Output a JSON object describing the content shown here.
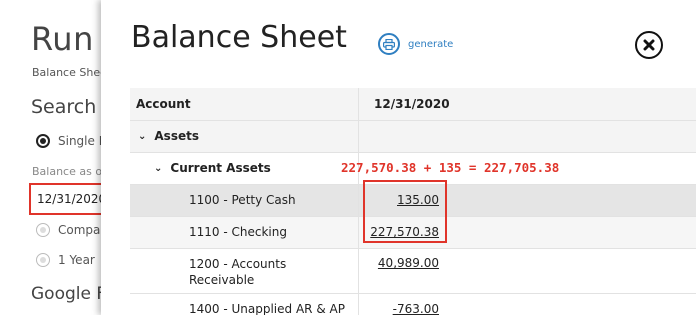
{
  "background": {
    "title": "Run",
    "subtitle": "Balance Shee",
    "search_heading": "Search C",
    "radio_options": [
      "Single F",
      "Compa",
      "1 Year"
    ],
    "balance_label": "Balance as o",
    "date_value": "12/31/2020",
    "google_heading": "Google F"
  },
  "modal": {
    "title": "Balance Sheet",
    "generate_label": "generate",
    "table": {
      "headers": {
        "account": "Account",
        "date": "12/31/2020"
      },
      "groups": {
        "assets": "Assets",
        "current_assets": "Current Assets"
      },
      "rows": [
        {
          "account": "1100 - Petty Cash",
          "amount": "135.00"
        },
        {
          "account": "1110 - Checking",
          "amount": "227,570.38"
        },
        {
          "account": "1200 - Accounts Receivable",
          "amount": "40,989.00"
        },
        {
          "account": "1400 - Unapplied AR & AP",
          "amount": "-763.00"
        }
      ]
    },
    "annotation": "227,570.38 + 135 = 227,705.38"
  },
  "colors": {
    "accent": "#2f7fc1",
    "highlight": "#e0342a"
  }
}
